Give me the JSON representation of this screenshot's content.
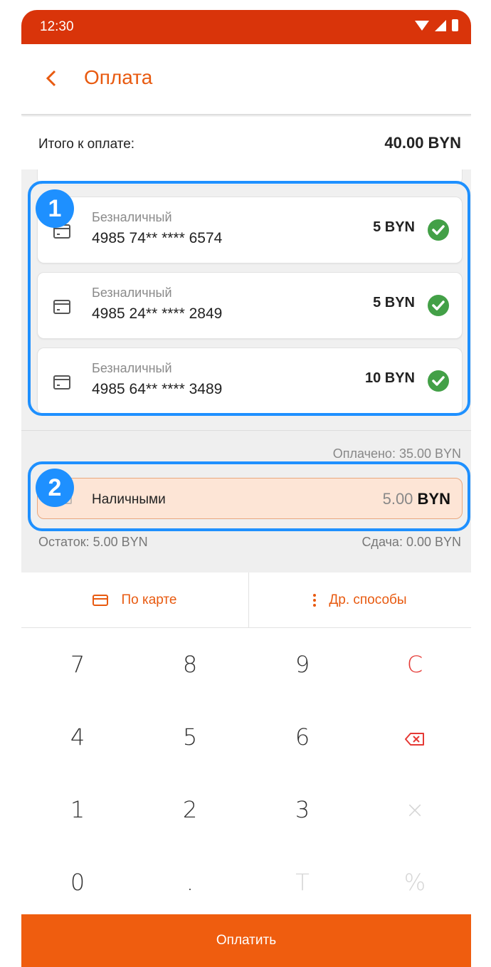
{
  "status_bar": {
    "time": "12:30"
  },
  "header": {
    "title": "Оплата"
  },
  "total": {
    "label": "Итого к оплате:",
    "value": "40.00 BYN"
  },
  "payments": [
    {
      "type": "Безналичный",
      "number": "4985 74** **** 6574",
      "amount": "5 BYN"
    },
    {
      "type": "Безналичный",
      "number": "4985 24** **** 2849",
      "amount": "5 BYN"
    },
    {
      "type": "Безналичный",
      "number": "4985 64** **** 3489",
      "amount": "10 BYN"
    }
  ],
  "annotations": {
    "badge_1": "1",
    "badge_2": "2"
  },
  "summary": {
    "paid": "Оплачено: 35.00 BYN",
    "cash_label": "Наличными",
    "cash_amount": "5.00",
    "cash_currency": "BYN",
    "remainder": "Остаток: 5.00 BYN",
    "change": "Сдача: 0.00 BYN"
  },
  "methods": {
    "card": "По карте",
    "other": "Др. способы"
  },
  "keypad": {
    "k7": "7",
    "k8": "8",
    "k9": "9",
    "clear": "C",
    "k4": "4",
    "k5": "5",
    "k6": "6",
    "k1": "1",
    "k2": "2",
    "k3": "3",
    "multiply": "×",
    "k0": "0",
    "dot": ".",
    "t": "T",
    "percent": "%"
  },
  "pay_button": "Оплатить",
  "colors": {
    "accent": "#e85a10",
    "status_bar": "#d9340a",
    "check": "#43a047",
    "highlight": "#1e90ff"
  }
}
